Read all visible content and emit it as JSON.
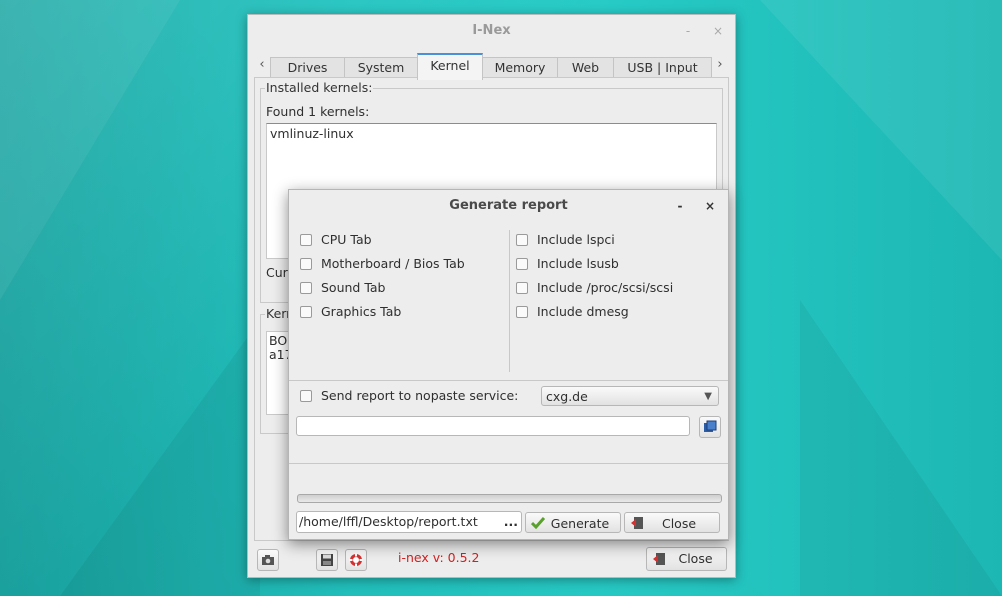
{
  "main_window": {
    "title": "I-Nex",
    "minimize": "-",
    "close": "×",
    "tab_arrow_left": "‹",
    "tab_arrow_right": "›",
    "tabs": [
      {
        "label": "Drives"
      },
      {
        "label": "System"
      },
      {
        "label": "Kernel"
      },
      {
        "label": "Memory"
      },
      {
        "label": "Web"
      },
      {
        "label": "USB | Input"
      }
    ],
    "active_tab": "Kernel",
    "installed_kernels_label": "Installed kernels:",
    "found_text": "Found 1 kernels:",
    "kernel_list": [
      "vmlinuz-linux"
    ],
    "current_label": "Curr",
    "kernel_group_label": "Kerne",
    "kernel_text_lines": [
      "BOO",
      "a17"
    ],
    "version": "i-nex v: 0.5.2",
    "close_button": "Close"
  },
  "dialog": {
    "title": "Generate report",
    "minimize": "-",
    "close": "×",
    "left_options": [
      "CPU Tab",
      "Motherboard / Bios Tab",
      "Sound Tab",
      "Graphics Tab"
    ],
    "right_options": [
      "Include lspci",
      "Include lsusb",
      "Include /proc/scsi/scsi",
      "Include dmesg"
    ],
    "nopaste_label": "Send report to nopaste service:",
    "nopaste_service": "cxg.de",
    "output_path": "/home/lffl/Desktop/report.txt",
    "browse": "...",
    "generate_button": "Generate",
    "close_button": "Close",
    "accent_color": "#4a90d9",
    "version_color": "#d42020"
  }
}
